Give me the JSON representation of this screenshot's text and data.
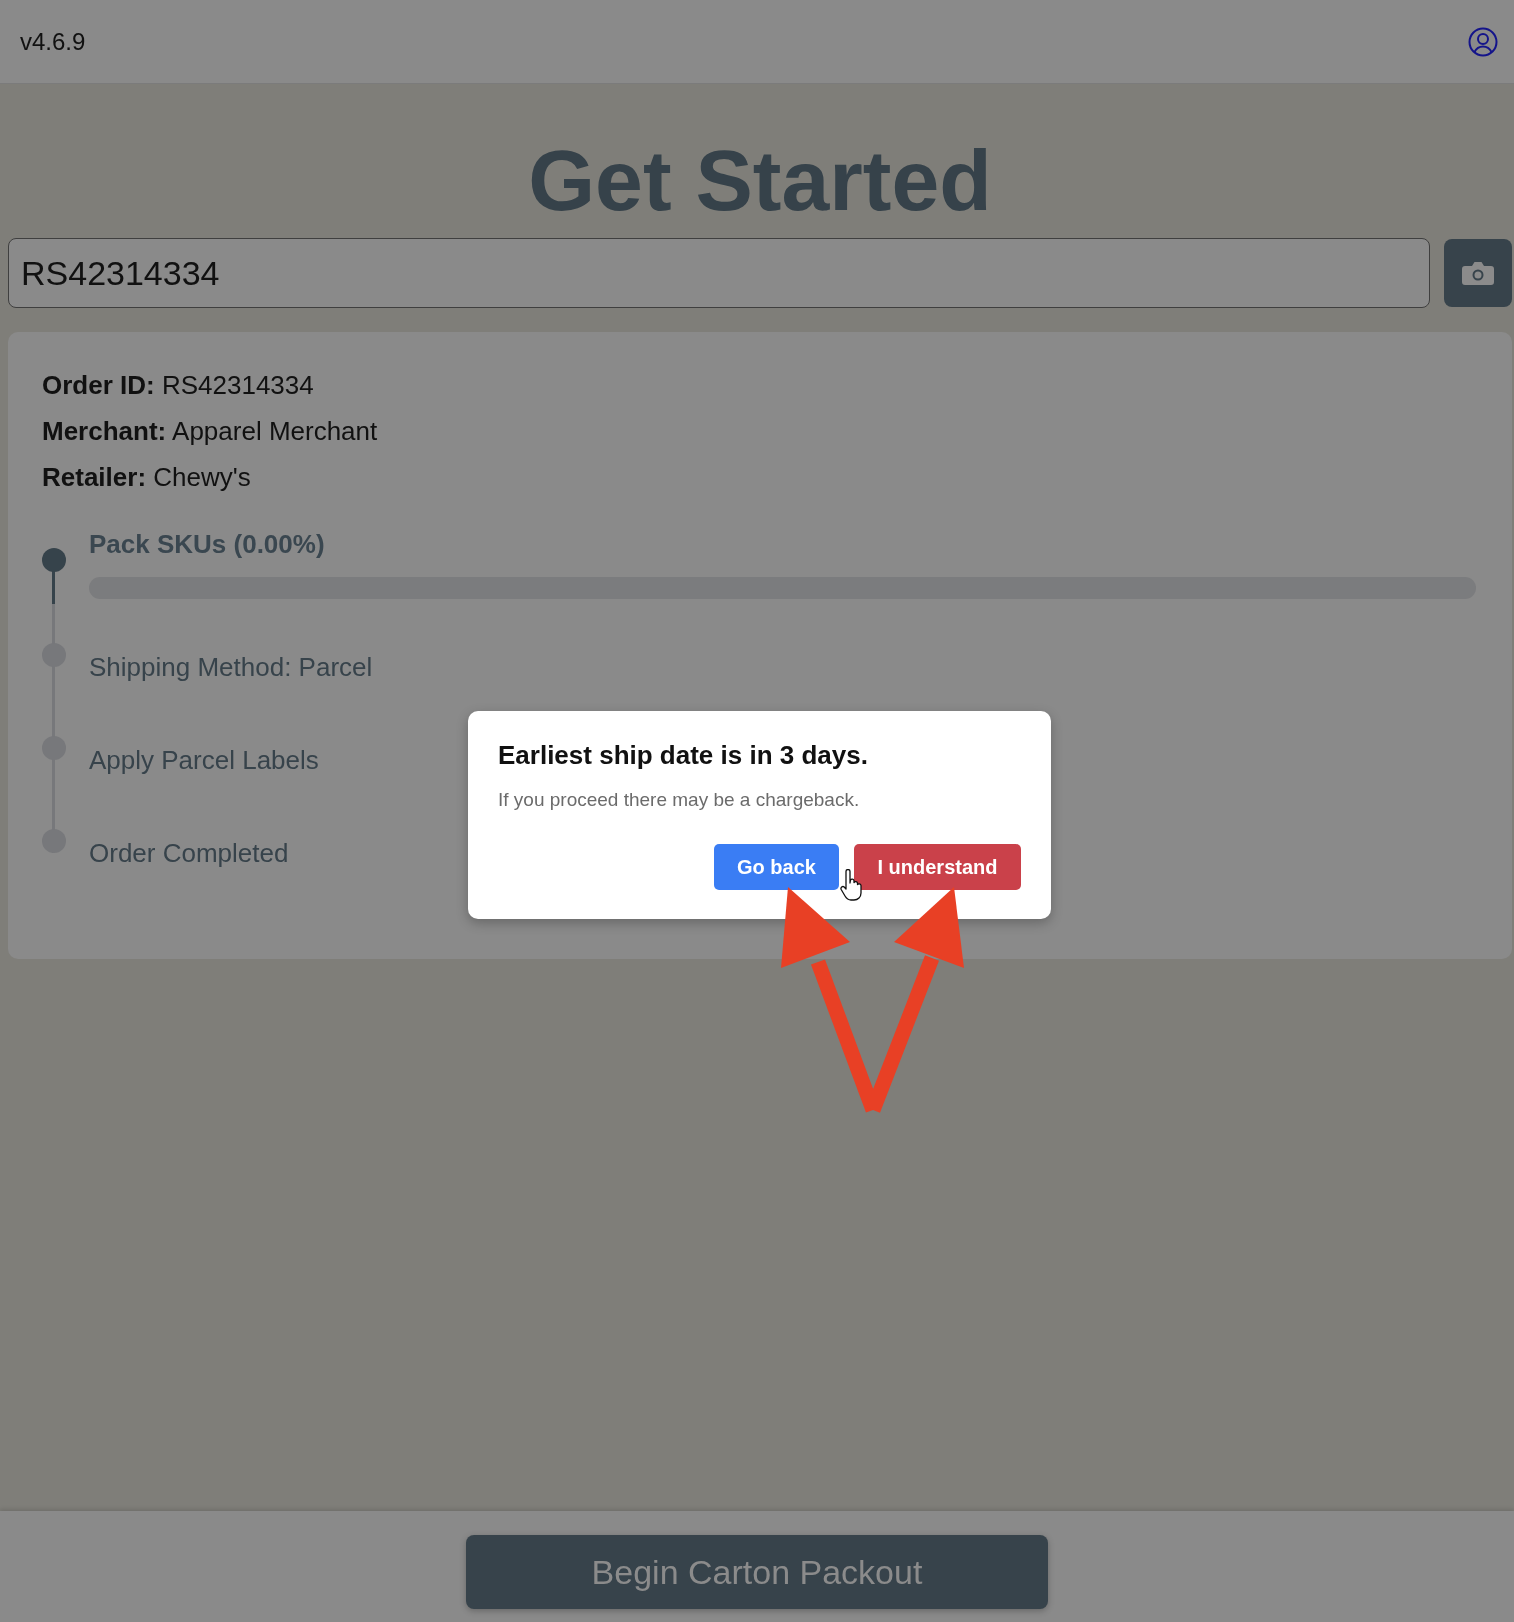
{
  "header": {
    "version": "v4.6.9"
  },
  "title": "Get Started",
  "order_search": {
    "value": "RS42314334"
  },
  "order_details": {
    "fields": [
      {
        "label": "Order ID:",
        "value": "RS42314334"
      },
      {
        "label": "Merchant:",
        "value": "Apparel Merchant"
      },
      {
        "label": "Retailer:",
        "value": "Chewy's"
      }
    ],
    "steps": [
      {
        "kind": "progress",
        "label": "Pack SKUs (0.00%)",
        "active": true,
        "level": 0
      },
      {
        "kind": "plain",
        "label": "Shipping Method: Parcel",
        "active": false
      },
      {
        "kind": "plain",
        "label": "Apply Parcel Labels",
        "active": false
      },
      {
        "kind": "plain",
        "label": "Order Completed",
        "active": false
      }
    ]
  },
  "dialog": {
    "title": "Earliest ship date is in 3 days.",
    "message": "If you proceed there may be a chargeback.",
    "buttons": [
      {
        "kind": "primary",
        "label": "Go back"
      },
      {
        "kind": "danger",
        "label": "I understand"
      }
    ]
  },
  "footer": {
    "button": "Begin Carton Packout"
  }
}
